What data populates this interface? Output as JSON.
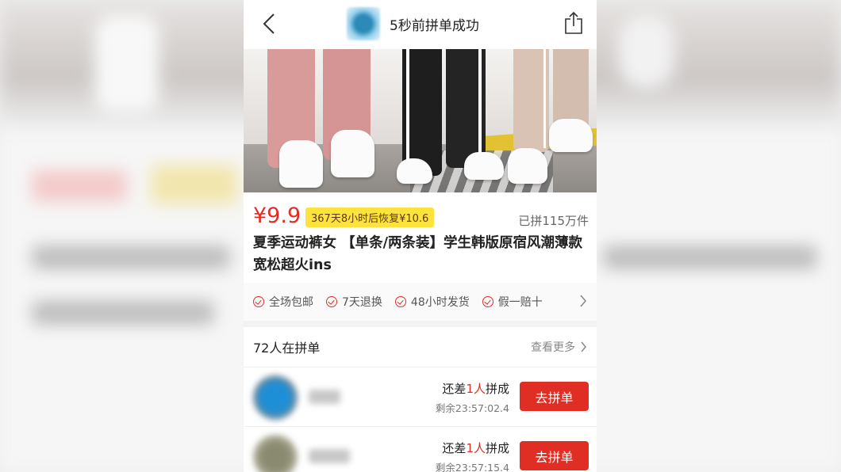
{
  "topbar": {
    "title": "5秒前拼单成功",
    "back_icon": "chevron-left-icon",
    "share_icon": "share-icon"
  },
  "product": {
    "price": "¥9.9",
    "promo": "367天8小时后恢复¥10.6",
    "sold": "已拼115万件",
    "title": "夏季运动裤女 【单条/两条装】学生韩版原宿风潮薄款宽松超火ins"
  },
  "guarantees": [
    "全场包邮",
    "7天退换",
    "48小时发货",
    "假一赔十"
  ],
  "group": {
    "title": "72人在拼单",
    "more": "查看更多",
    "rows": [
      {
        "need_prefix": "还差",
        "need_count": "1人",
        "need_suffix": "拼成",
        "timer": "剩余23:57:02.4",
        "button": "去拼单"
      },
      {
        "need_prefix": "还差",
        "need_count": "1人",
        "need_suffix": "拼成",
        "timer": "剩余23:57:15.4",
        "button": "去拼单"
      }
    ]
  },
  "colors": {
    "accent": "#e02e24",
    "promo_bg": "#ffe33d"
  }
}
